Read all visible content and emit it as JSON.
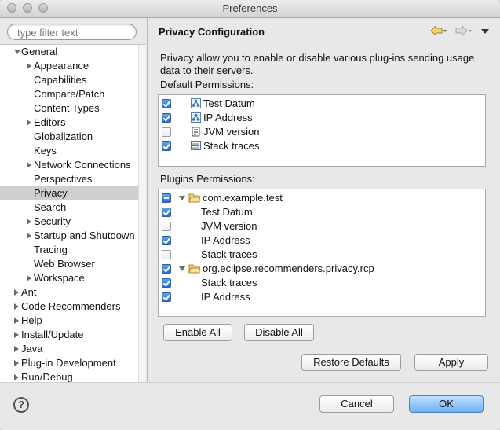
{
  "window": {
    "title": "Preferences"
  },
  "filter": {
    "placeholder": "type filter text"
  },
  "tree": [
    {
      "label": "General",
      "level": 0,
      "expander": "down"
    },
    {
      "label": "Appearance",
      "level": 1,
      "expander": "right"
    },
    {
      "label": "Capabilities",
      "level": 1,
      "expander": "none"
    },
    {
      "label": "Compare/Patch",
      "level": 1,
      "expander": "none"
    },
    {
      "label": "Content Types",
      "level": 1,
      "expander": "none"
    },
    {
      "label": "Editors",
      "level": 1,
      "expander": "right"
    },
    {
      "label": "Globalization",
      "level": 1,
      "expander": "none"
    },
    {
      "label": "Keys",
      "level": 1,
      "expander": "none"
    },
    {
      "label": "Network Connections",
      "level": 1,
      "expander": "right"
    },
    {
      "label": "Perspectives",
      "level": 1,
      "expander": "none"
    },
    {
      "label": "Privacy",
      "level": 1,
      "expander": "none",
      "selected": true
    },
    {
      "label": "Search",
      "level": 1,
      "expander": "none"
    },
    {
      "label": "Security",
      "level": 1,
      "expander": "right"
    },
    {
      "label": "Startup and Shutdown",
      "level": 1,
      "expander": "right"
    },
    {
      "label": "Tracing",
      "level": 1,
      "expander": "none"
    },
    {
      "label": "Web Browser",
      "level": 1,
      "expander": "none"
    },
    {
      "label": "Workspace",
      "level": 1,
      "expander": "right"
    },
    {
      "label": "Ant",
      "level": 0,
      "expander": "right"
    },
    {
      "label": "Code Recommenders",
      "level": 0,
      "expander": "right"
    },
    {
      "label": "Help",
      "level": 0,
      "expander": "right"
    },
    {
      "label": "Install/Update",
      "level": 0,
      "expander": "right"
    },
    {
      "label": "Java",
      "level": 0,
      "expander": "right"
    },
    {
      "label": "Plug-in Development",
      "level": 0,
      "expander": "right"
    },
    {
      "label": "Run/Debug",
      "level": 0,
      "expander": "right"
    }
  ],
  "page": {
    "title": "Privacy Configuration",
    "description": "Privacy allow you to enable or disable various plug-ins sending usage data to their servers.",
    "default_label": "Default Permissions:",
    "plugins_label": "Plugins Permissions:"
  },
  "default_permissions": [
    {
      "label": "Test Datum",
      "checked": true,
      "icon": "datum-icon"
    },
    {
      "label": "IP Address",
      "checked": true,
      "icon": "ip-address-icon"
    },
    {
      "label": "JVM version",
      "checked": false,
      "icon": "jvm-icon"
    },
    {
      "label": "Stack traces",
      "checked": true,
      "icon": "stack-trace-icon"
    }
  ],
  "plugin_permissions": [
    {
      "label": "com.example.test",
      "state": "mixed",
      "type": "plugin",
      "icon": "folder-icon"
    },
    {
      "label": "Test Datum",
      "state": "checked",
      "type": "permission"
    },
    {
      "label": "JVM version",
      "state": "unchecked",
      "type": "permission"
    },
    {
      "label": "IP Address",
      "state": "checked",
      "type": "permission"
    },
    {
      "label": "Stack traces",
      "state": "unchecked",
      "type": "permission"
    },
    {
      "label": "org.eclipse.recommenders.privacy.rcp",
      "state": "checked",
      "type": "plugin",
      "icon": "folder-icon"
    },
    {
      "label": "Stack traces",
      "state": "checked",
      "type": "permission"
    },
    {
      "label": "IP Address",
      "state": "checked",
      "type": "permission"
    }
  ],
  "buttons": {
    "enable_all": "Enable All",
    "disable_all": "Disable All",
    "restore_defaults": "Restore Defaults",
    "apply": "Apply",
    "cancel": "Cancel",
    "ok": "OK"
  },
  "help": {
    "glyph": "?"
  },
  "colors": {
    "accent": "#2a6fd1",
    "selection": "#cfcfcf",
    "folder": "#e8b93e"
  }
}
